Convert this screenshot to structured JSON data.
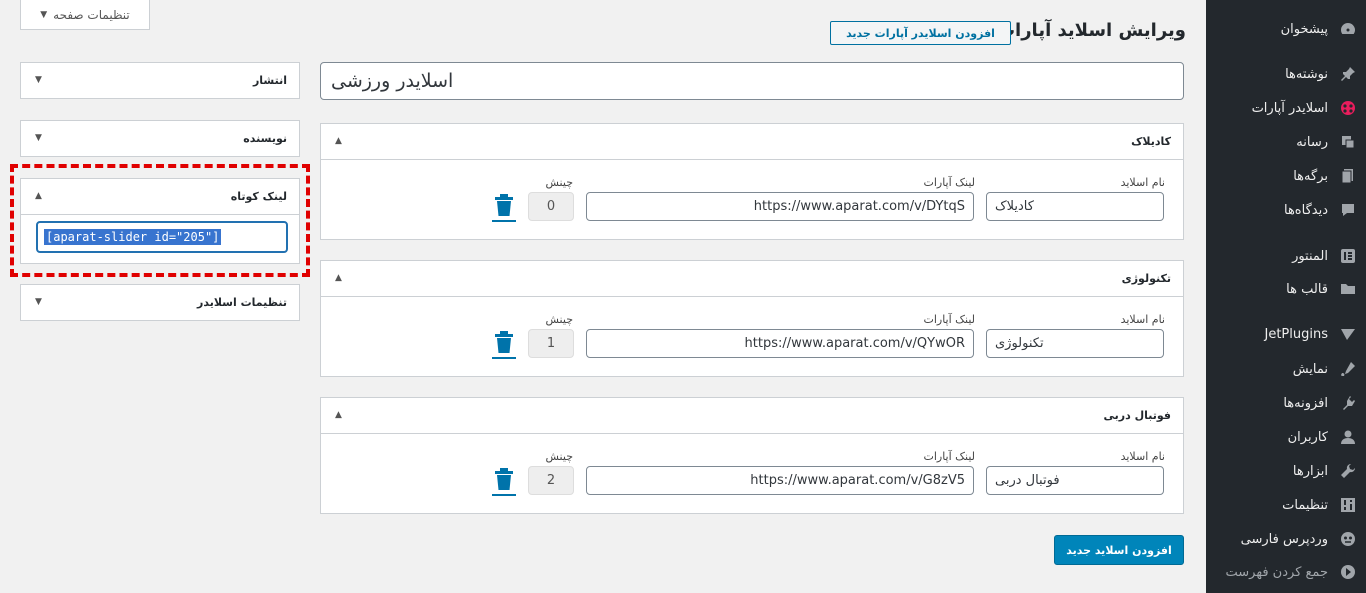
{
  "header": {
    "title": "ویرایش اسلاید آپارات",
    "add_new_label": "افزودن اسلایدر آپارات جدید",
    "screen_options_label": "تنظیمات صفحه"
  },
  "post_title": "اسلایدر ورزشی",
  "field_labels": {
    "name": "نام اسلاید",
    "link": "لینک آپارات",
    "order": "چینش"
  },
  "slides": [
    {
      "heading": "کادیلاک",
      "name": "کادیلاک",
      "link": "https://www.aparat.com/v/DYtqS",
      "order": "0"
    },
    {
      "heading": "تکنولوژی",
      "name": "تکنولوژی",
      "link": "https://www.aparat.com/v/QYwOR",
      "order": "1"
    },
    {
      "heading": "فوتبال دربی",
      "name": "فوتبال دربی",
      "link": "https://www.aparat.com/v/G8zV5",
      "order": "2"
    }
  ],
  "add_slide_label": "افزودن اسلاید جدید",
  "meta_boxes": {
    "publish": "انتشار",
    "author": "نویسنده",
    "shortlink": "لینک کوتاه",
    "shortcode": "[aparat-slider id=\"205\"]",
    "slider_settings": "تنظیمات اسلایدر"
  },
  "sidebar": {
    "items": [
      {
        "label": "پیشخوان",
        "icon": "dashboard-icon"
      },
      {
        "label": "نوشته‌ها",
        "icon": "pin-icon"
      },
      {
        "label": "اسلایدر آپارات",
        "icon": "aparat-icon"
      },
      {
        "label": "رسانه",
        "icon": "media-icon"
      },
      {
        "label": "برگه‌ها",
        "icon": "pages-icon"
      },
      {
        "label": "دیدگاه‌ها",
        "icon": "comments-icon"
      },
      {
        "label": "المنتور",
        "icon": "elementor-icon"
      },
      {
        "label": "قالب ها",
        "icon": "folder-icon"
      },
      {
        "label": "JetPlugins",
        "icon": "jetplugins-icon"
      },
      {
        "label": "نمایش",
        "icon": "appearance-icon"
      },
      {
        "label": "افزونه‌ها",
        "icon": "plugins-icon"
      },
      {
        "label": "کاربران",
        "icon": "users-icon"
      },
      {
        "label": "ابزارها",
        "icon": "tools-icon"
      },
      {
        "label": "تنظیمات",
        "icon": "settings-icon"
      },
      {
        "label": "وردپرس فارسی",
        "icon": "wp-persian-icon"
      },
      {
        "label": "جمع کردن فهرست",
        "icon": "collapse-icon"
      }
    ]
  },
  "colors": {
    "sidebar_bg": "#23282d",
    "accent": "#0073aa",
    "highlight_dash": "#e00000"
  }
}
